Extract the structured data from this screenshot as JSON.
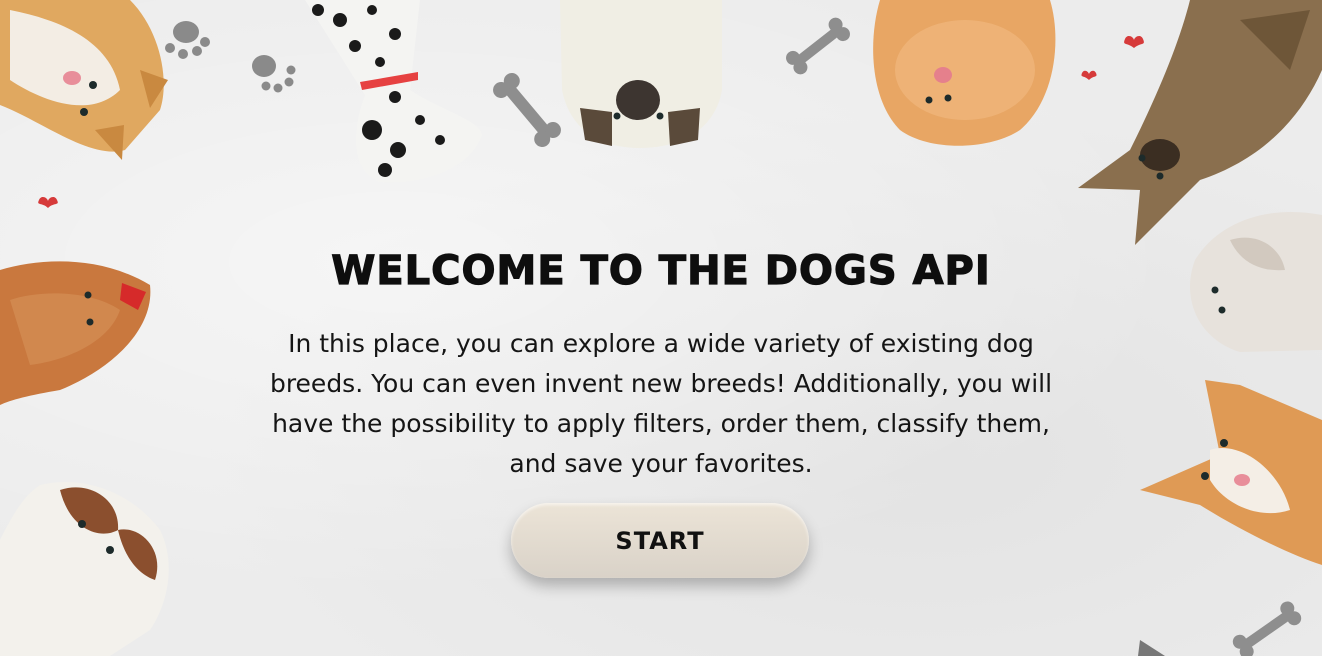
{
  "hero": {
    "title": "WELCOME TO THE DOGS API",
    "description": "In this place, you can explore a wide variety of existing dog breeds. You can even invent new breeds! Additionally, you will have the possibility to apply filters, order them, classify them, and save your favorites.",
    "start_label": "START"
  },
  "decorations": {
    "icons": [
      "paw-print-icon",
      "bone-icon",
      "heart-icon",
      "dog-illustration"
    ]
  },
  "colors": {
    "background": "#ebebeb",
    "button_top": "#ece4d7",
    "button_bottom": "#d9d2c8",
    "heart": "#d63a3a"
  }
}
